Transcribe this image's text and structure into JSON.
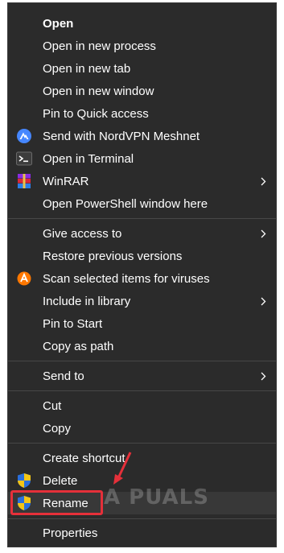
{
  "menu": {
    "group1": [
      {
        "label": "Open",
        "bold": true
      },
      {
        "label": "Open in new process"
      },
      {
        "label": "Open in new tab"
      },
      {
        "label": "Open in new window"
      },
      {
        "label": "Pin to Quick access"
      },
      {
        "label": "Send with NordVPN Meshnet",
        "icon": "nordvpn-icon"
      },
      {
        "label": "Open in Terminal",
        "icon": "terminal-icon"
      },
      {
        "label": "WinRAR",
        "icon": "winrar-icon",
        "submenu": true
      },
      {
        "label": "Open PowerShell window here"
      }
    ],
    "group2": [
      {
        "label": "Give access to",
        "submenu": true
      },
      {
        "label": "Restore previous versions"
      },
      {
        "label": "Scan selected items for viruses",
        "icon": "avast-icon"
      },
      {
        "label": "Include in library",
        "submenu": true
      },
      {
        "label": "Pin to Start"
      },
      {
        "label": "Copy as path"
      }
    ],
    "group3": [
      {
        "label": "Send to",
        "submenu": true
      }
    ],
    "group4": [
      {
        "label": "Cut"
      },
      {
        "label": "Copy"
      }
    ],
    "group5": [
      {
        "label": "Create shortcut"
      },
      {
        "label": "Delete",
        "icon": "uac-shield-icon"
      },
      {
        "label": "Rename",
        "icon": "uac-shield-icon",
        "highlighted": true
      }
    ],
    "group6": [
      {
        "label": "Properties"
      }
    ]
  },
  "watermark": {
    "text": "A  PUALS"
  },
  "colors": {
    "menu_bg": "#2b2b2b",
    "separator": "#474747",
    "highlight_box": "#e5303a",
    "annotation_arrow": "#e5303a"
  }
}
